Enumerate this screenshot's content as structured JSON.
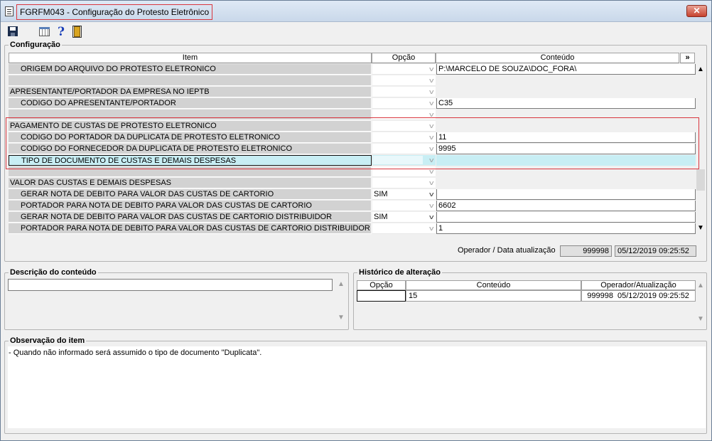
{
  "window": {
    "title": "FGRFM043 - Configuração do Protesto Eletrônico",
    "close_label": "✕"
  },
  "toolbar": {
    "icons": [
      "save-icon",
      "calendar-grid-icon",
      "help-icon",
      "exit-door-icon"
    ],
    "help_glyph": "?"
  },
  "config": {
    "group_title": "Configuração",
    "columns": [
      "Item",
      "Opção",
      "Conteúdo"
    ],
    "expand_label": "»",
    "rows": [
      {
        "item": "ORIGEM DO ARQUIVO DO PROTESTO ELETRONICO",
        "opcao": "",
        "conteudo": "P:\\MARCELO DE SOUZA\\DOC_FORA\\"
      },
      {
        "item": "",
        "opcao": "",
        "conteudo": ""
      },
      {
        "item": "APRESENTANTE/PORTADOR DA EMPRESA NO IEPTB",
        "opcao": "",
        "conteudo": ""
      },
      {
        "item": "CODIGO DO APRESENTANTE/PORTADOR",
        "opcao": "",
        "conteudo": "C35"
      },
      {
        "item": "",
        "opcao": "",
        "conteudo": ""
      },
      {
        "item": "PAGAMENTO DE CUSTAS DE PROTESTO ELETRONICO",
        "opcao": "",
        "conteudo": ""
      },
      {
        "item": "CODIGO DO PORTADOR DA DUPLICATA DE PROTESTO ELETRONICO",
        "opcao": "",
        "conteudo": "11"
      },
      {
        "item": "CODIGO DO FORNECEDOR DA DUPLICATA DE PROTESTO ELETRONICO",
        "opcao": "",
        "conteudo": "9995"
      },
      {
        "item": "TIPO DE DOCUMENTO DE CUSTAS E DEMAIS DESPESAS",
        "opcao": "",
        "conteudo": ""
      },
      {
        "item": "",
        "opcao": "",
        "conteudo": ""
      },
      {
        "item": "VALOR DAS CUSTAS E DEMAIS DESPESAS",
        "opcao": "",
        "conteudo": ""
      },
      {
        "item": "GERAR NOTA DE DEBITO PARA VALOR DAS CUSTAS DE CARTORIO",
        "opcao": "SIM",
        "conteudo": ""
      },
      {
        "item": "PORTADOR PARA NOTA DE DEBITO PARA VALOR DAS CUSTAS DE CARTORIO",
        "opcao": "",
        "conteudo": "6602"
      },
      {
        "item": "GERAR NOTA DE DEBITO PARA VALOR DAS CUSTAS DE CARTORIO DISTRIBUIDOR",
        "opcao": "SIM",
        "conteudo": ""
      },
      {
        "item": "PORTADOR PARA NOTA DE DEBITO PARA VALOR DAS CUSTAS DE CARTORIO DISTRIBUIDOR",
        "opcao": "",
        "conteudo": "1"
      }
    ],
    "operator_label": "Operador / Data atualização",
    "operator_code": "999998",
    "updated_at": "05/12/2019 09:25:52"
  },
  "descricao": {
    "group_title": "Descrição do conteúdo",
    "value": ""
  },
  "historico": {
    "group_title": "Histórico de alteração",
    "columns": [
      "Opção",
      "Conteúdo",
      "Operador/Atualização"
    ],
    "rows": [
      {
        "opcao": "",
        "conteudo": "15",
        "operador": "999998",
        "data": "05/12/2019 09:25:52"
      }
    ]
  },
  "observacao": {
    "group_title": "Observação do item",
    "text": "- Quando não informado será assumido o tipo de documento \"Duplicata\"."
  }
}
